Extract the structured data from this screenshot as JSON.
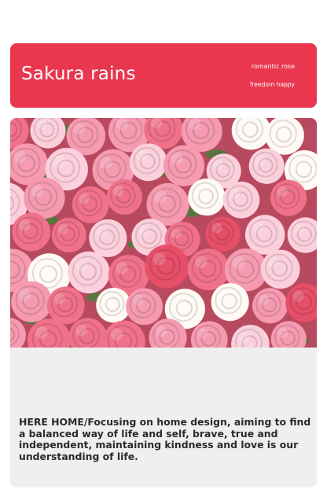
{
  "banner": {
    "title": "Sakura rains",
    "tag_1": "romantic rose",
    "tag_2": "freedom happy",
    "color": "#e8374f"
  },
  "photo": {
    "subject": "knitted-roses",
    "palette": [
      "#f0718a",
      "#f59ab0",
      "#fbd0dc",
      "#fffaf5",
      "#e64f68",
      "#4f7a3c"
    ]
  },
  "description": {
    "text": "HERE HOME/Focusing on home design, aiming to find a balanced way of life and self, brave, true and independent, maintaining kindness and love is our understanding of life."
  }
}
